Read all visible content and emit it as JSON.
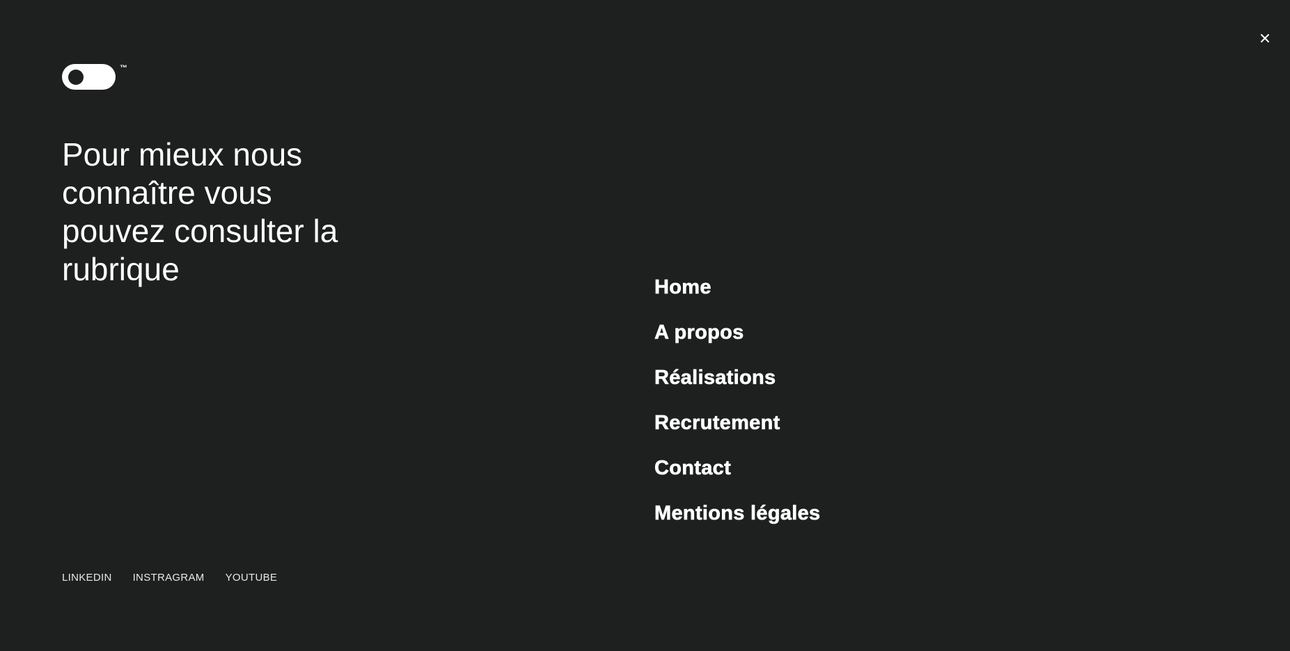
{
  "logo": {
    "trademark": "™",
    "icon": "toggle-switch-logo"
  },
  "close": {
    "icon": "close-icon",
    "glyph": "×"
  },
  "headline": "Pour mieux nous connaître vous pouvez consulter la rubrique",
  "nav": {
    "items": [
      {
        "label": "Home"
      },
      {
        "label": "A propos"
      },
      {
        "label": "Réalisations"
      },
      {
        "label": "Recrutement"
      },
      {
        "label": "Contact"
      },
      {
        "label": "Mentions légales"
      }
    ]
  },
  "social": {
    "items": [
      {
        "label": "LINKEDIN"
      },
      {
        "label": "INSTRAGRAM"
      },
      {
        "label": "YOUTUBE"
      }
    ]
  },
  "colors": {
    "background": "#1e1f1f",
    "foreground": "#ffffff"
  }
}
